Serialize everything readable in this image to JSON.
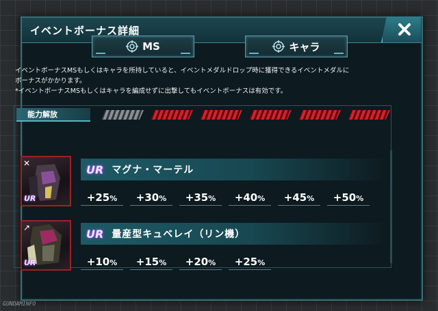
{
  "dialog": {
    "title": "イベントボーナス詳細",
    "close_label": "✕"
  },
  "tabs": [
    {
      "label": "MS"
    },
    {
      "label": "キャラ"
    }
  ],
  "description": {
    "line1": "イベントボーナスMSもしくはキャラを所持していると、イベントメダルドロップ時に獲得できるイベントメダルに",
    "line2": "ボーナスがかかります。",
    "line3": "*イベントボーナスMSもしくはキャラを編成せずに出撃してもイベントボーナスは有効です。"
  },
  "ability": {
    "label": "能力解放",
    "levels_unlocked": 5,
    "levels_total": 6
  },
  "units": [
    {
      "rarity": "UR",
      "name": "マグナ・マーテル",
      "bonuses": [
        {
          "num": "+25",
          "unit": "%"
        },
        {
          "num": "+30",
          "unit": "%"
        },
        {
          "num": "+35",
          "unit": "%"
        },
        {
          "num": "+40",
          "unit": "%"
        },
        {
          "num": "+45",
          "unit": "%"
        },
        {
          "num": "+50",
          "unit": "%"
        }
      ]
    },
    {
      "rarity": "UR",
      "name": "量産型キュベレイ（リン機）",
      "bonuses": [
        {
          "num": "+10",
          "unit": "%"
        },
        {
          "num": "+15",
          "unit": "%"
        },
        {
          "num": "+20",
          "unit": "%"
        },
        {
          "num": "+25",
          "unit": "%"
        }
      ]
    }
  ],
  "watermark": "GUNDAMINFO",
  "colors": {
    "accent": "#58b6c4",
    "frame": "#3b6f78",
    "unlock_red": "#d8202a",
    "locked_grey": "#8a9096"
  }
}
